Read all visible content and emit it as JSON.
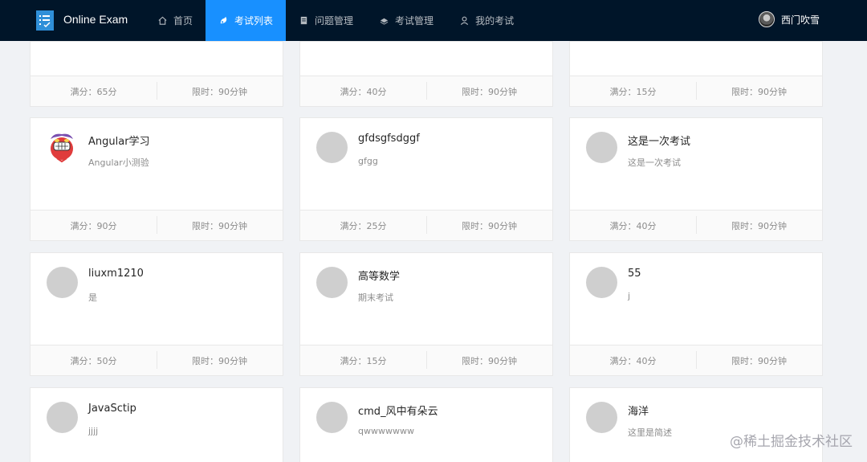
{
  "app": {
    "brand": "Online Exam",
    "user_name": "西门吹雪"
  },
  "nav": [
    {
      "label": "首页",
      "icon": "home-icon"
    },
    {
      "label": "考试列表",
      "icon": "exam-list-icon",
      "active": true
    },
    {
      "label": "问题管理",
      "icon": "question-icon"
    },
    {
      "label": "考试管理",
      "icon": "exam-manage-icon"
    },
    {
      "label": "我的考试",
      "icon": "user-icon"
    }
  ],
  "cards": [
    {
      "title": "",
      "desc": "",
      "score": "满分：65分",
      "time": "限时：90分钟"
    },
    {
      "title": "",
      "desc": "",
      "score": "满分：40分",
      "time": "限时：90分钟"
    },
    {
      "title": "",
      "desc": "",
      "score": "满分：15分",
      "time": "限时：90分钟"
    },
    {
      "title": "Angular学习",
      "desc": "Angular小测验",
      "score": "满分：90分",
      "time": "限时：90分钟",
      "avatar": "cartoon-avatar"
    },
    {
      "title": "gfdsgfsdggf",
      "desc": "gfgg",
      "score": "满分：25分",
      "time": "限时：90分钟"
    },
    {
      "title": "这是一次考试",
      "desc": "这是一次考试",
      "score": "满分：40分",
      "time": "限时：90分钟"
    },
    {
      "title": "liuxm1210",
      "desc": "是",
      "score": "满分：50分",
      "time": "限时：90分钟"
    },
    {
      "title": "高等数学",
      "desc": "期末考试",
      "score": "满分：15分",
      "time": "限时：90分钟"
    },
    {
      "title": "55",
      "desc": "j",
      "score": "满分：40分",
      "time": "限时：90分钟"
    },
    {
      "title": "JavaSctip",
      "desc": "jjjj",
      "score": "",
      "time": ""
    },
    {
      "title": "cmd_风中有朵云",
      "desc": "qwwwwwww",
      "score": "",
      "time": ""
    },
    {
      "title": "海洋",
      "desc": "这里是简述",
      "score": "",
      "time": ""
    }
  ],
  "watermark": "@稀土掘金技术社区",
  "colors": {
    "header_bg": "#001529",
    "active_nav": "#1890ff",
    "page_bg": "#f0f2f5"
  }
}
